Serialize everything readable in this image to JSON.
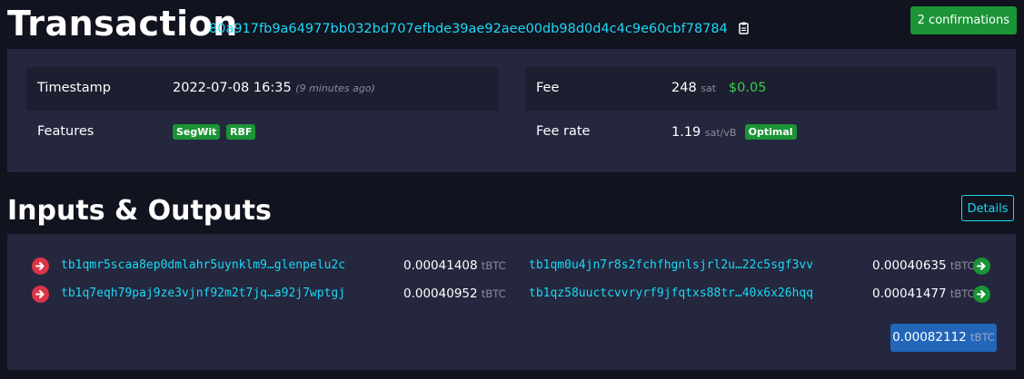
{
  "header": {
    "title": "Transaction",
    "txid": "80a917fb9a64977bb032bd707efbde39ae92aee00db98d0d4c4c9e60cbf78784",
    "confirmations": "2 confirmations"
  },
  "details": {
    "timestamp_label": "Timestamp",
    "timestamp_value": "2022-07-08 16:35",
    "timestamp_relative": "(9 minutes ago)",
    "features_label": "Features",
    "features": [
      "SegWit",
      "RBF"
    ],
    "fee_label": "Fee",
    "fee_value": "248",
    "fee_unit": "sat",
    "fee_fiat": "$0.05",
    "feerate_label": "Fee rate",
    "feerate_value": "1.19",
    "feerate_unit": "sat/vB",
    "feerate_badge": "Optimal"
  },
  "io": {
    "title": "Inputs & Outputs",
    "details_button": "Details",
    "unit": "tBTC",
    "inputs": [
      {
        "address": "tb1qmr5scaa8ep0dmlahr5uynklm9…glenpelu2c",
        "amount": "0.00041408"
      },
      {
        "address": "tb1q7eqh79paj9ze3vjnf92m2t7jq…a92j7wptgj",
        "amount": "0.00040952"
      }
    ],
    "outputs": [
      {
        "address": "tb1qm0u4jn7r8s2fchfhgnlsjrl2u…22c5sgf3vv",
        "amount": "0.00040635"
      },
      {
        "address": "tb1qz58uuctcvvryrf9jfqtxs88tr…40x6x26hqq",
        "amount": "0.00041477"
      }
    ],
    "total": "0.00082112",
    "colors": {
      "input_arrow": "#dc3545",
      "output_arrow": "#1a9436",
      "link": "#1bd8f4"
    }
  }
}
